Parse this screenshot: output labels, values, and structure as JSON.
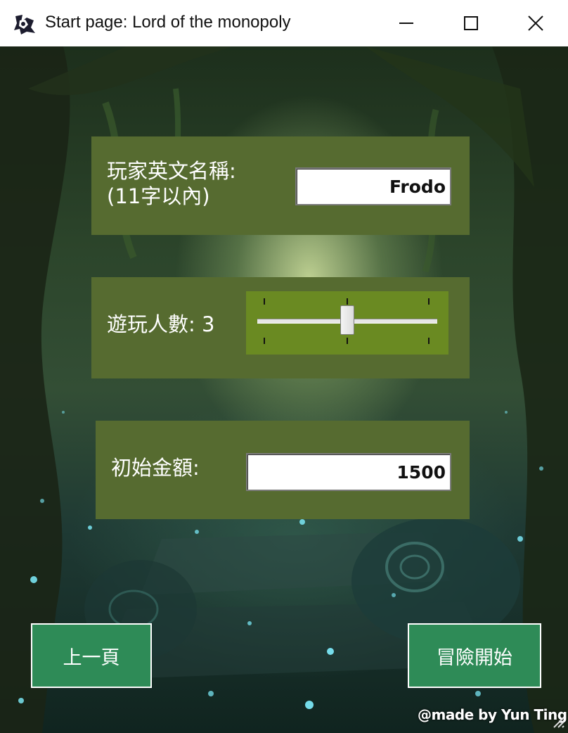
{
  "window": {
    "title": "Start page: Lord of the monopoly",
    "icon": "app-logo-icon",
    "controls": [
      "minimize-icon",
      "maximize-icon",
      "close-icon"
    ]
  },
  "name_panel": {
    "label_line1": "玩家英文名稱:",
    "label_line2": "(11字以內)",
    "value": "Frodo"
  },
  "players_panel": {
    "label": "遊玩人數:",
    "count": "3",
    "slider_value": 0.5
  },
  "money_panel": {
    "label": "初始金額:",
    "value": "1500"
  },
  "buttons": {
    "prev_label": "上一頁",
    "start_label": "冒險開始"
  },
  "credit": "@made by Yun Ting",
  "colors": {
    "panel": "#566b30",
    "slider_bg": "#6a8a22",
    "button": "#2e8b57"
  }
}
